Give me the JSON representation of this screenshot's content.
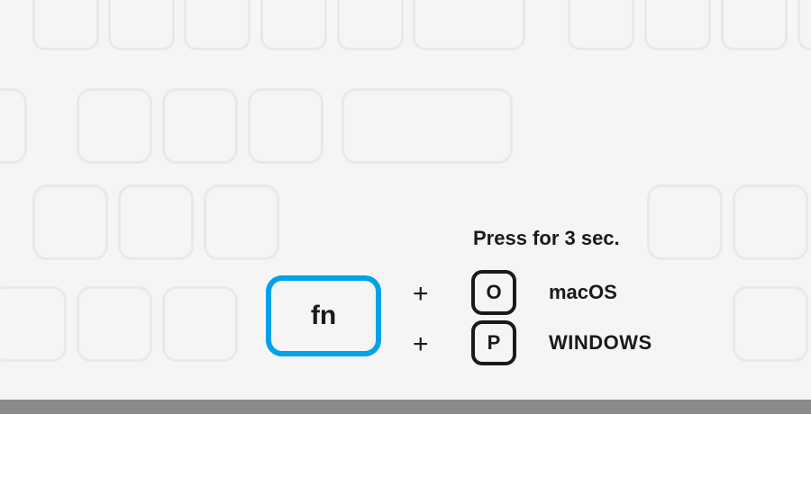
{
  "instruction": {
    "press_label": "Press for 3 sec.",
    "fn_label": "fn",
    "plus": "+",
    "combos": [
      {
        "key": "O",
        "os": "macOS"
      },
      {
        "key": "P",
        "os": "WINDOWS"
      }
    ]
  }
}
